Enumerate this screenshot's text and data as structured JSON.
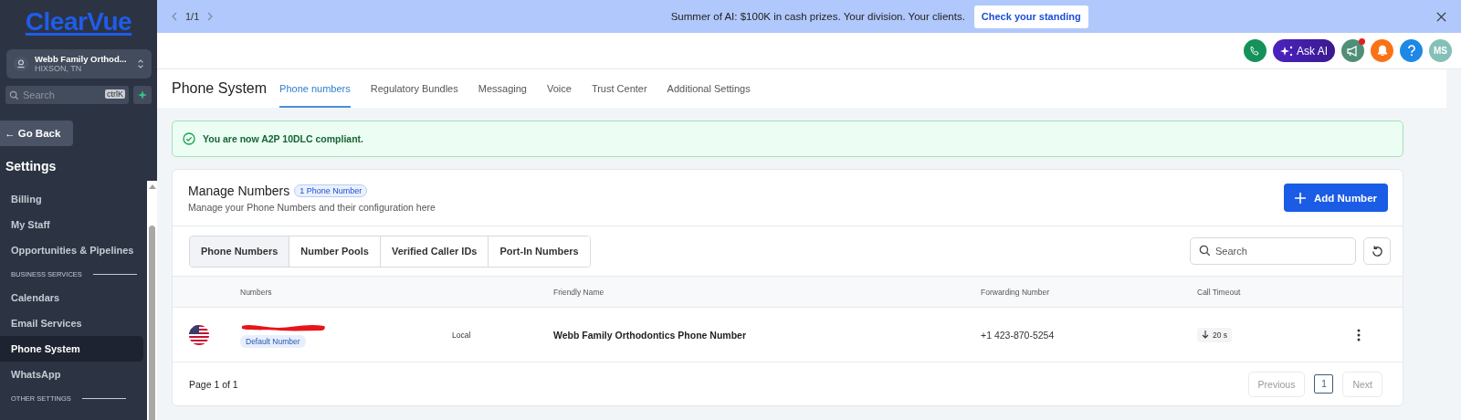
{
  "sidebar": {
    "brand": "ClearVue",
    "account": {
      "name": "Webb Family Orthod...",
      "location": "HIXSON, TN"
    },
    "search": {
      "placeholder": "Search",
      "shortcut": "ctrlK"
    },
    "back": "← Go Back",
    "heading": "Settings",
    "items": [
      {
        "kind": "item",
        "label": "Billing",
        "selected": false
      },
      {
        "kind": "item",
        "label": "My Staff",
        "selected": false
      },
      {
        "kind": "item",
        "label": "Opportunities & Pipelines",
        "selected": false
      },
      {
        "kind": "section",
        "label": "BUSINESS SERVICES"
      },
      {
        "kind": "item",
        "label": "Calendars",
        "selected": false
      },
      {
        "kind": "item",
        "label": "Email Services",
        "selected": false
      },
      {
        "kind": "item",
        "label": "Phone System",
        "selected": true
      },
      {
        "kind": "item",
        "label": "WhatsApp",
        "selected": false
      },
      {
        "kind": "section",
        "label": "OTHER SETTINGS"
      }
    ]
  },
  "banner": {
    "pager": "1/1",
    "message": "Summer of AI: $100K in cash prizes. Your division. Your clients.",
    "cta": "Check your standing"
  },
  "header": {
    "ask_ai": "Ask AI",
    "avatar": "MS"
  },
  "page": {
    "title": "Phone System",
    "tabs": [
      {
        "label": "Phone numbers",
        "selected": true
      },
      {
        "label": "Regulatory Bundles",
        "selected": false
      },
      {
        "label": "Messaging",
        "selected": false
      },
      {
        "label": "Voice",
        "selected": false
      },
      {
        "label": "Trust Center",
        "selected": false
      },
      {
        "label": "Additional Settings",
        "selected": false
      }
    ]
  },
  "alert": "You are now A2P 10DLC compliant.",
  "card": {
    "title": "Manage Numbers",
    "count": "1 Phone Number",
    "subtitle": "Manage your Phone Numbers and their configuration here",
    "add_button": "Add Number",
    "subtabs": [
      {
        "label": "Phone Numbers",
        "selected": true
      },
      {
        "label": "Number Pools",
        "selected": false
      },
      {
        "label": "Verified Caller IDs",
        "selected": false
      },
      {
        "label": "Port-In Numbers",
        "selected": false
      }
    ],
    "search": {
      "placeholder": "Search"
    },
    "table": {
      "columns": [
        "Numbers",
        "Friendly Name",
        "Forwarding Number",
        "Call Timeout"
      ],
      "rows": [
        {
          "badge": "Default Number",
          "type": "Local",
          "friendly_name": "Webb Family Orthodontics Phone Number",
          "forwarding": "+1 423-870-5254",
          "timeout": "20 s"
        }
      ]
    },
    "footer": {
      "page_info": "Page 1 of 1",
      "previous": {
        "label": "Previous",
        "disabled": true
      },
      "page": "1",
      "next": {
        "label": "Next",
        "disabled": true
      }
    }
  }
}
